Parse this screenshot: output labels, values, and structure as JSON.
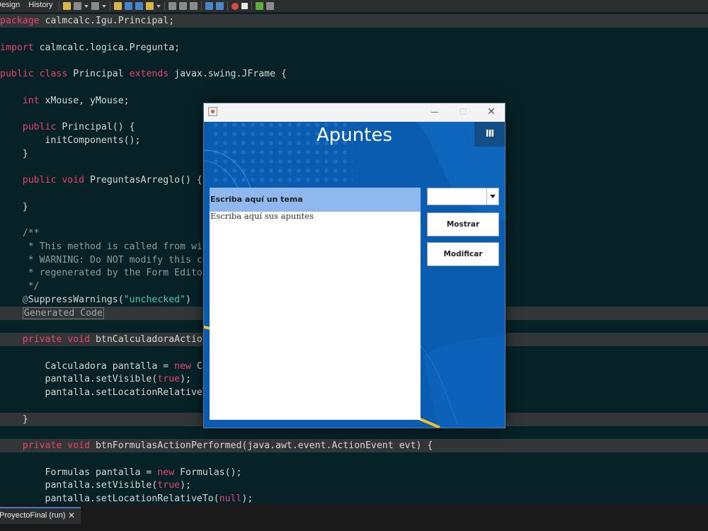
{
  "ide": {
    "toolbar": {
      "design_tab": "Design",
      "history_tab": "History"
    },
    "code_lines": [
      {
        "parts": [
          {
            "t": "package",
            "c": "kw"
          },
          {
            "t": " calmcalc.Igu.Principal;"
          }
        ],
        "hl": true
      },
      {
        "parts": []
      },
      {
        "parts": [
          {
            "t": "import",
            "c": "kw"
          },
          {
            "t": " calmcalc.logica.Pregunta;"
          }
        ]
      },
      {
        "parts": []
      },
      {
        "parts": [
          {
            "t": "public class",
            "c": "kw"
          },
          {
            "t": " Principal "
          },
          {
            "t": "extends",
            "c": "kw"
          },
          {
            "t": " javax.swing.JFrame {"
          }
        ]
      },
      {
        "parts": []
      },
      {
        "parts": [
          {
            "t": "    "
          },
          {
            "t": "int",
            "c": "kw"
          },
          {
            "t": " xMouse, yMouse;"
          }
        ]
      },
      {
        "parts": []
      },
      {
        "parts": [
          {
            "t": "    "
          },
          {
            "t": "public",
            "c": "kw"
          },
          {
            "t": " Principal() {"
          }
        ]
      },
      {
        "parts": [
          {
            "t": "        initComponents();"
          }
        ]
      },
      {
        "parts": [
          {
            "t": "    }"
          }
        ]
      },
      {
        "parts": []
      },
      {
        "parts": [
          {
            "t": "    "
          },
          {
            "t": "public void",
            "c": "kw"
          },
          {
            "t": " PreguntasArreglo() {"
          }
        ]
      },
      {
        "parts": []
      },
      {
        "parts": [
          {
            "t": "    }"
          }
        ]
      },
      {
        "parts": []
      },
      {
        "parts": [
          {
            "t": "    /**",
            "c": "cm"
          }
        ]
      },
      {
        "parts": [
          {
            "t": "     * This method is called from within the constructor to",
            "c": "cm"
          }
        ]
      },
      {
        "parts": [
          {
            "t": "     * WARNING: Do NOT modify this code. The content of this",
            "c": "cm"
          }
        ]
      },
      {
        "parts": [
          {
            "t": "     * regenerated by the Form Editor.",
            "c": "cm"
          }
        ]
      },
      {
        "parts": [
          {
            "t": "     */",
            "c": "cm"
          }
        ]
      },
      {
        "parts": [
          {
            "t": "    @",
            "c": "cm"
          },
          {
            "t": "SuppressWarnings("
          },
          {
            "t": "\"unchecked\"",
            "c": "str"
          },
          {
            "t": ")"
          }
        ]
      },
      {
        "parts": [
          {
            "t": "    "
          },
          {
            "t": "Generated Code",
            "c": "fold"
          }
        ],
        "hl": true
      },
      {
        "parts": []
      },
      {
        "parts": [
          {
            "t": "    "
          },
          {
            "t": "private void",
            "c": "kw"
          },
          {
            "t": " btnCalculadoraActionPerformed(java.awt.event.ActionEvent evt) {"
          }
        ],
        "hl": true
      },
      {
        "parts": []
      },
      {
        "parts": [
          {
            "t": "        Calculadora pantalla = "
          },
          {
            "t": "new",
            "c": "kw"
          },
          {
            "t": " Calculadora();"
          }
        ]
      },
      {
        "parts": [
          {
            "t": "        pantalla.setVisible("
          },
          {
            "t": "true",
            "c": "kw"
          },
          {
            "t": ");"
          }
        ]
      },
      {
        "parts": [
          {
            "t": "        pantalla.setLocationRelativeTo("
          },
          {
            "t": "null",
            "c": "kw"
          },
          {
            "t": ");"
          }
        ]
      },
      {
        "parts": []
      },
      {
        "parts": [
          {
            "t": "    }"
          }
        ],
        "hl": true
      },
      {
        "parts": []
      },
      {
        "parts": [
          {
            "t": "    "
          },
          {
            "t": "private void",
            "c": "kw"
          },
          {
            "t": " btnFormulasActionPerformed(java.awt.event.ActionEvent evt) {"
          }
        ],
        "hl": true
      },
      {
        "parts": []
      },
      {
        "parts": [
          {
            "t": "        Formulas pantalla = "
          },
          {
            "t": "new",
            "c": "kw"
          },
          {
            "t": " Formulas();"
          }
        ]
      },
      {
        "parts": [
          {
            "t": "        pantalla.setVisible("
          },
          {
            "t": "true",
            "c": "kw"
          },
          {
            "t": ");"
          }
        ]
      },
      {
        "parts": [
          {
            "t": "        pantalla.setLocationRelativeTo("
          },
          {
            "t": "null",
            "c": "kw"
          },
          {
            "t": ");"
          }
        ]
      }
    ],
    "output_tab": {
      "label": "ProyectoFinal (run)",
      "close": "✕"
    }
  },
  "dialog": {
    "title": "Apuntes",
    "menu_button": "III",
    "window_controls": {
      "minimize": "—",
      "maximize": "☐",
      "close": "✕"
    },
    "topic_field": "Escriba aquí un tema",
    "notes_area": "Escriba aquí sus apuntes",
    "combo_value": "",
    "buttons": {
      "show": "Mostrar",
      "modify": "Modificar"
    },
    "colors": {
      "background": "#0a5cb0",
      "topic_bg": "#8fb8ee",
      "accent_yellow": "#f2c12e"
    }
  }
}
